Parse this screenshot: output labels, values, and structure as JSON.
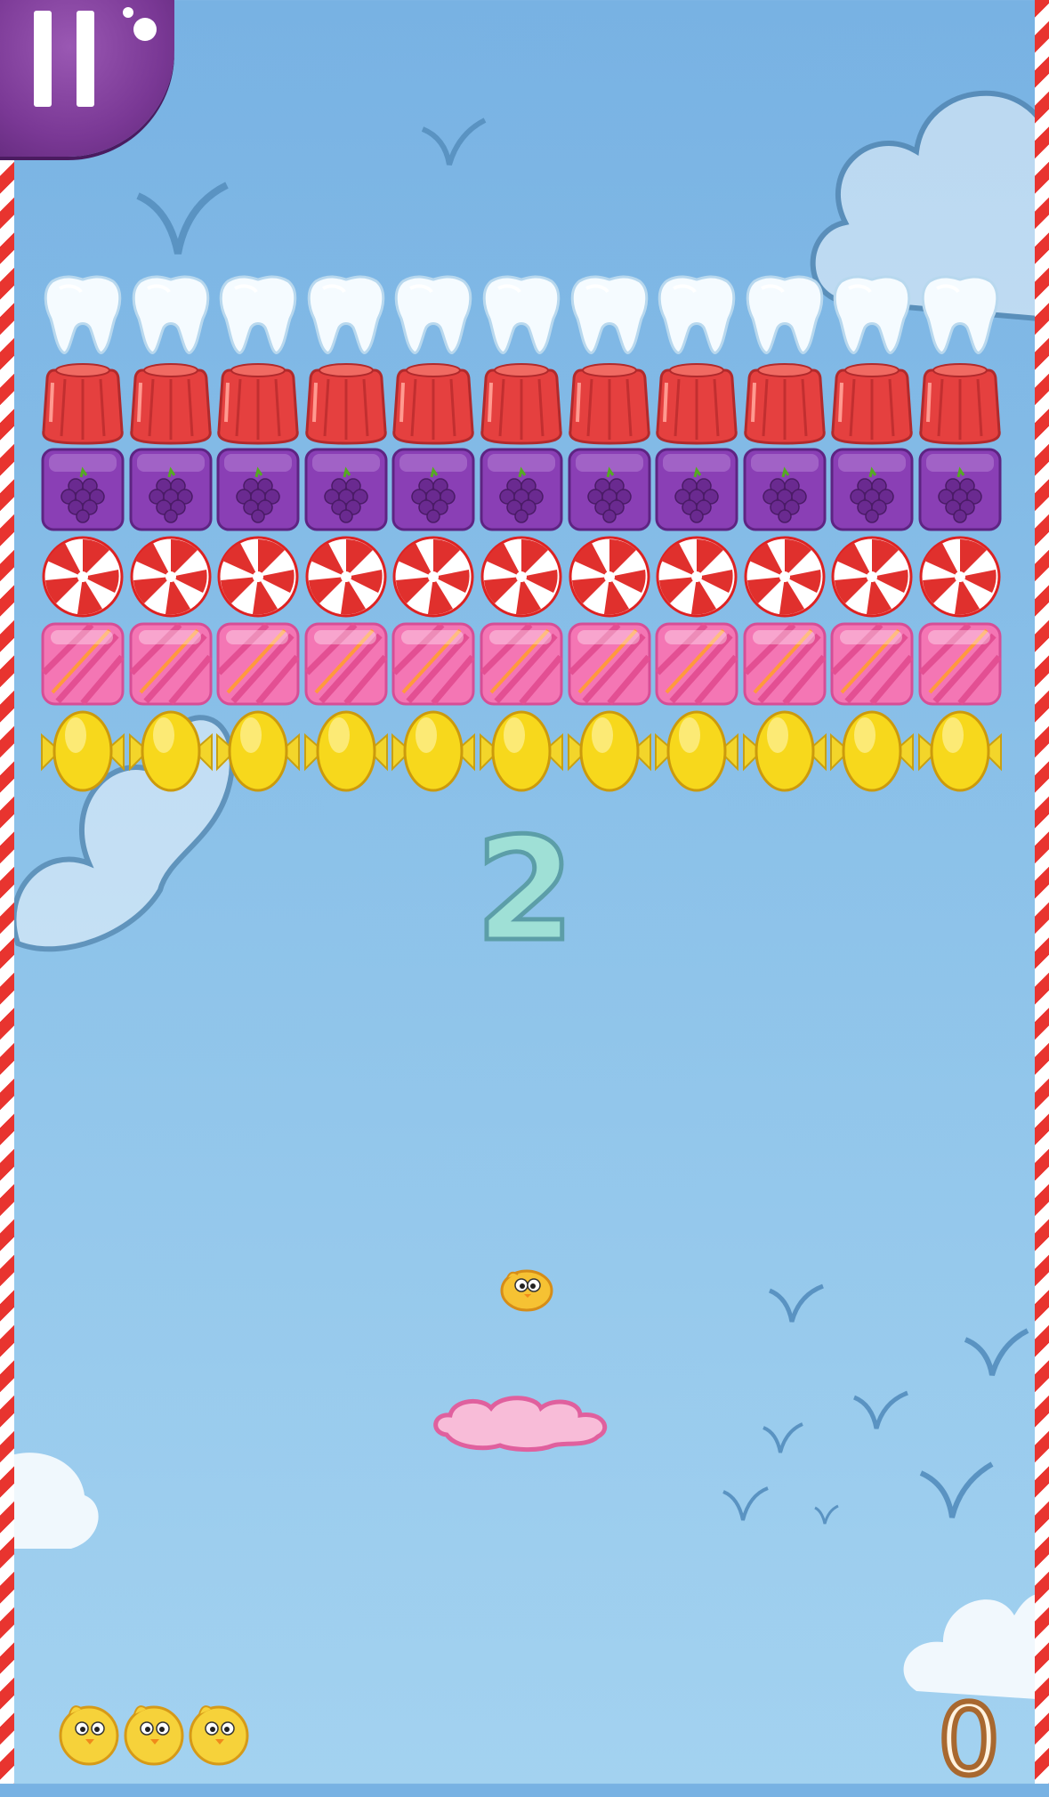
{
  "hud": {
    "pause_button": "pause",
    "level_number": "2",
    "score": "0",
    "lives_remaining": 3
  },
  "bricks": {
    "columns": 11,
    "rows": [
      {
        "type": "tooth",
        "count": 11
      },
      {
        "type": "red-jelly",
        "count": 11
      },
      {
        "type": "purple-berry-candy",
        "count": 11
      },
      {
        "type": "peppermint-swirl",
        "count": 11
      },
      {
        "type": "pink-striped-candy",
        "count": 11
      },
      {
        "type": "yellow-wrapped-candy",
        "count": 11
      }
    ]
  },
  "icons": {
    "ball": "yellow-chick-icon",
    "paddle": "pink-cloud-icon",
    "life": "yellow-chick-icon"
  },
  "colors": {
    "sky": "#78b2e3",
    "border_red": "#e8342f",
    "pause_purple": "#7a3895",
    "level_fill": "#9fe0d6",
    "score_outline": "#a8682f"
  }
}
